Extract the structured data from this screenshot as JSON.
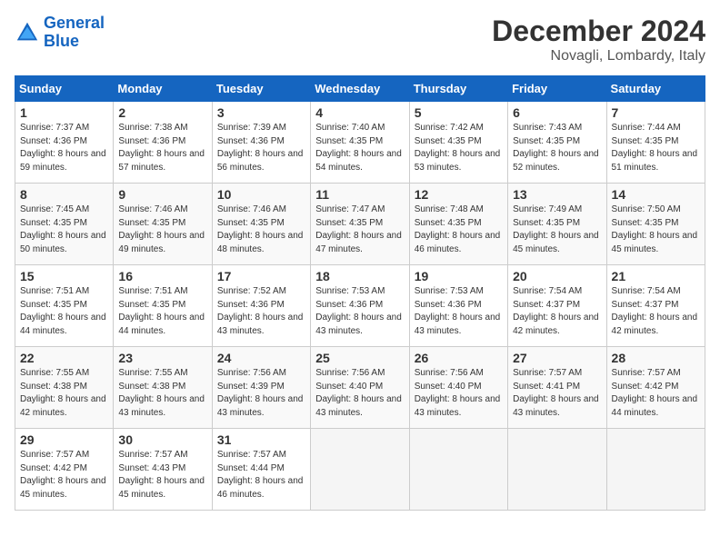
{
  "header": {
    "logo_line1": "General",
    "logo_line2": "Blue",
    "month": "December 2024",
    "location": "Novagli, Lombardy, Italy"
  },
  "weekdays": [
    "Sunday",
    "Monday",
    "Tuesday",
    "Wednesday",
    "Thursday",
    "Friday",
    "Saturday"
  ],
  "weeks": [
    [
      {
        "day": "1",
        "sunrise": "7:37 AM",
        "sunset": "4:36 PM",
        "daylight": "8 hours and 59 minutes."
      },
      {
        "day": "2",
        "sunrise": "7:38 AM",
        "sunset": "4:36 PM",
        "daylight": "8 hours and 57 minutes."
      },
      {
        "day": "3",
        "sunrise": "7:39 AM",
        "sunset": "4:36 PM",
        "daylight": "8 hours and 56 minutes."
      },
      {
        "day": "4",
        "sunrise": "7:40 AM",
        "sunset": "4:35 PM",
        "daylight": "8 hours and 54 minutes."
      },
      {
        "day": "5",
        "sunrise": "7:42 AM",
        "sunset": "4:35 PM",
        "daylight": "8 hours and 53 minutes."
      },
      {
        "day": "6",
        "sunrise": "7:43 AM",
        "sunset": "4:35 PM",
        "daylight": "8 hours and 52 minutes."
      },
      {
        "day": "7",
        "sunrise": "7:44 AM",
        "sunset": "4:35 PM",
        "daylight": "8 hours and 51 minutes."
      }
    ],
    [
      {
        "day": "8",
        "sunrise": "7:45 AM",
        "sunset": "4:35 PM",
        "daylight": "8 hours and 50 minutes."
      },
      {
        "day": "9",
        "sunrise": "7:46 AM",
        "sunset": "4:35 PM",
        "daylight": "8 hours and 49 minutes."
      },
      {
        "day": "10",
        "sunrise": "7:46 AM",
        "sunset": "4:35 PM",
        "daylight": "8 hours and 48 minutes."
      },
      {
        "day": "11",
        "sunrise": "7:47 AM",
        "sunset": "4:35 PM",
        "daylight": "8 hours and 47 minutes."
      },
      {
        "day": "12",
        "sunrise": "7:48 AM",
        "sunset": "4:35 PM",
        "daylight": "8 hours and 46 minutes."
      },
      {
        "day": "13",
        "sunrise": "7:49 AM",
        "sunset": "4:35 PM",
        "daylight": "8 hours and 45 minutes."
      },
      {
        "day": "14",
        "sunrise": "7:50 AM",
        "sunset": "4:35 PM",
        "daylight": "8 hours and 45 minutes."
      }
    ],
    [
      {
        "day": "15",
        "sunrise": "7:51 AM",
        "sunset": "4:35 PM",
        "daylight": "8 hours and 44 minutes."
      },
      {
        "day": "16",
        "sunrise": "7:51 AM",
        "sunset": "4:35 PM",
        "daylight": "8 hours and 44 minutes."
      },
      {
        "day": "17",
        "sunrise": "7:52 AM",
        "sunset": "4:36 PM",
        "daylight": "8 hours and 43 minutes."
      },
      {
        "day": "18",
        "sunrise": "7:53 AM",
        "sunset": "4:36 PM",
        "daylight": "8 hours and 43 minutes."
      },
      {
        "day": "19",
        "sunrise": "7:53 AM",
        "sunset": "4:36 PM",
        "daylight": "8 hours and 43 minutes."
      },
      {
        "day": "20",
        "sunrise": "7:54 AM",
        "sunset": "4:37 PM",
        "daylight": "8 hours and 42 minutes."
      },
      {
        "day": "21",
        "sunrise": "7:54 AM",
        "sunset": "4:37 PM",
        "daylight": "8 hours and 42 minutes."
      }
    ],
    [
      {
        "day": "22",
        "sunrise": "7:55 AM",
        "sunset": "4:38 PM",
        "daylight": "8 hours and 42 minutes."
      },
      {
        "day": "23",
        "sunrise": "7:55 AM",
        "sunset": "4:38 PM",
        "daylight": "8 hours and 43 minutes."
      },
      {
        "day": "24",
        "sunrise": "7:56 AM",
        "sunset": "4:39 PM",
        "daylight": "8 hours and 43 minutes."
      },
      {
        "day": "25",
        "sunrise": "7:56 AM",
        "sunset": "4:40 PM",
        "daylight": "8 hours and 43 minutes."
      },
      {
        "day": "26",
        "sunrise": "7:56 AM",
        "sunset": "4:40 PM",
        "daylight": "8 hours and 43 minutes."
      },
      {
        "day": "27",
        "sunrise": "7:57 AM",
        "sunset": "4:41 PM",
        "daylight": "8 hours and 43 minutes."
      },
      {
        "day": "28",
        "sunrise": "7:57 AM",
        "sunset": "4:42 PM",
        "daylight": "8 hours and 44 minutes."
      }
    ],
    [
      {
        "day": "29",
        "sunrise": "7:57 AM",
        "sunset": "4:42 PM",
        "daylight": "8 hours and 45 minutes."
      },
      {
        "day": "30",
        "sunrise": "7:57 AM",
        "sunset": "4:43 PM",
        "daylight": "8 hours and 45 minutes."
      },
      {
        "day": "31",
        "sunrise": "7:57 AM",
        "sunset": "4:44 PM",
        "daylight": "8 hours and 46 minutes."
      },
      null,
      null,
      null,
      null
    ]
  ]
}
